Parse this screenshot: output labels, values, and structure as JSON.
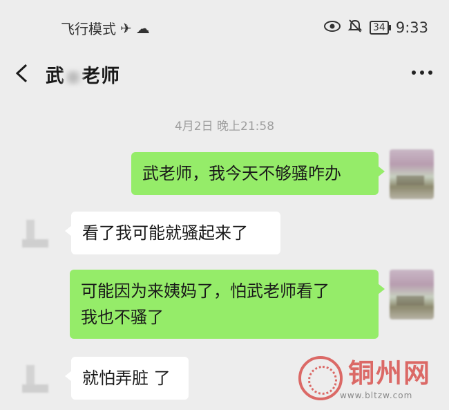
{
  "status_bar": {
    "airplane_mode_label": "飞行模式",
    "airplane_icon": "airplane-icon",
    "cloud_icon": "cloud-icon",
    "eye_icon": "eye-icon",
    "mute_icon": "bell-off-icon",
    "battery": "34",
    "time": "9:33"
  },
  "chat": {
    "title_prefix": "武",
    "title_suffix": "老师",
    "timestamp": "4月2日 晚上21:58"
  },
  "messages": [
    {
      "side": "sent",
      "text": "武老师，我今天不够骚咋办"
    },
    {
      "side": "recv",
      "text": "看了我可能就骚起来了"
    },
    {
      "side": "sent",
      "lines": [
        "可能因为来姨妈了，怕武老师看了",
        "我也不骚了"
      ]
    },
    {
      "side": "recv",
      "text": "就怕弄脏 了"
    }
  ],
  "watermark": {
    "name": "铜州网",
    "url": "www.bltzw.com"
  },
  "colors": {
    "background": "#ededed",
    "sent_bubble": "#95ec69",
    "received_bubble": "#ffffff",
    "watermark": "#d8534f"
  }
}
